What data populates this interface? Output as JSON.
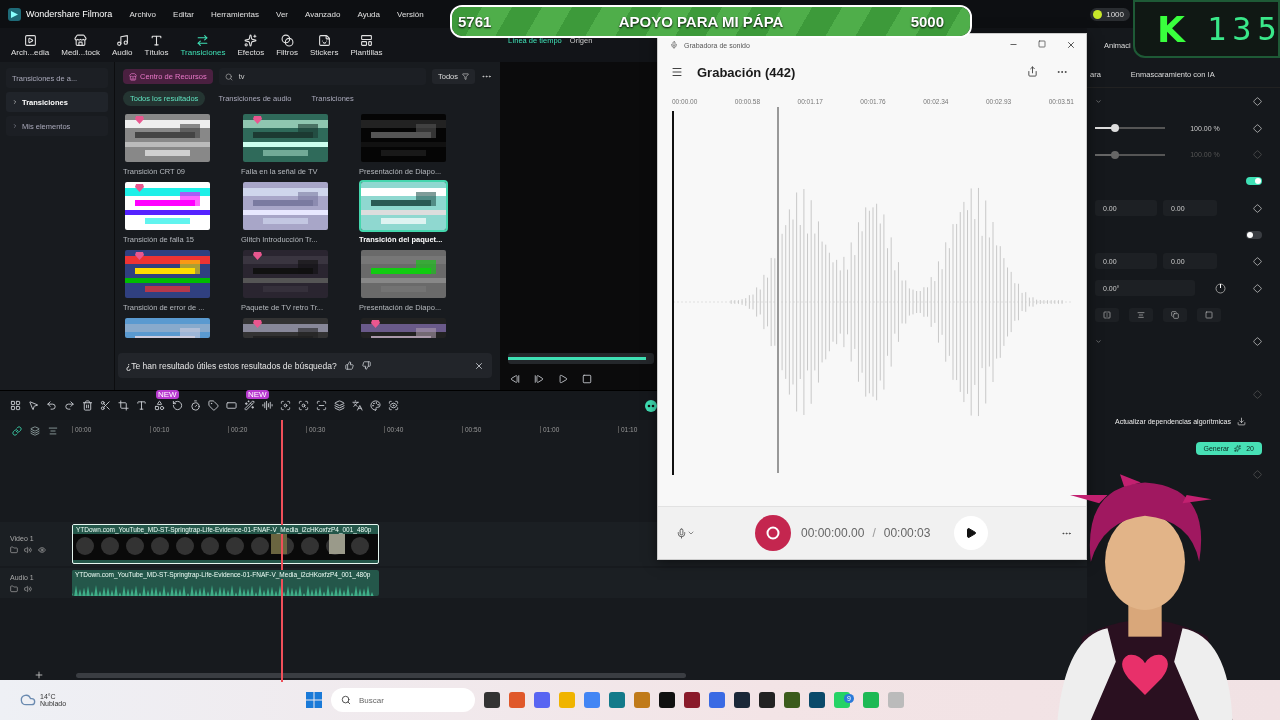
{
  "app": {
    "title": "Wondershare Filmora",
    "menu": [
      "Archivo",
      "Editar",
      "Herramientas",
      "Ver",
      "Avanzado",
      "Ayuda",
      "Versión"
    ],
    "credits": "1000"
  },
  "toolbar": [
    {
      "label": "Arch...edia",
      "selected": false
    },
    {
      "label": "Medi...tock",
      "selected": false
    },
    {
      "label": "Audio",
      "selected": false
    },
    {
      "label": "Títulos",
      "selected": false
    },
    {
      "label": "Transiciones",
      "selected": true
    },
    {
      "label": "Efectos",
      "selected": false
    },
    {
      "label": "Filtros",
      "selected": false
    },
    {
      "label": "Stickers",
      "selected": false
    },
    {
      "label": "Plantillas",
      "selected": false
    }
  ],
  "sidebar": [
    {
      "label": "Transiciones de a...",
      "selected": false
    },
    {
      "label": "Transiciones",
      "selected": true,
      "expanded": false
    },
    {
      "label": "Mis elementos",
      "selected": false,
      "expanded": false
    }
  ],
  "browser": {
    "resource_button": "Centro de Recursos",
    "search": {
      "value": "tv"
    },
    "filter": "Todos",
    "tabs": [
      {
        "label": "Todos los resultados",
        "selected": true
      },
      {
        "label": "Transiciones de audio",
        "selected": false
      },
      {
        "label": "Transiciones",
        "selected": false
      }
    ],
    "results": [
      {
        "title": "Transición CRT 09",
        "premium": true,
        "selected": false
      },
      {
        "title": "Falla en la señal de TV",
        "premium": true,
        "selected": false
      },
      {
        "title": "Presentación de Diapo...",
        "premium": false,
        "selected": false
      },
      {
        "title": "Transición de falla 15",
        "premium": true,
        "selected": false
      },
      {
        "title": "Glitch Introducción Tr...",
        "premium": false,
        "selected": false
      },
      {
        "title": "Transición del paquet...",
        "premium": false,
        "selected": true
      },
      {
        "title": "Transición de error de ...",
        "premium": true,
        "selected": false
      },
      {
        "title": "Paquete de TV retro Tr...",
        "premium": true,
        "selected": false
      },
      {
        "title": "Presentación de Diapo...",
        "premium": false,
        "selected": false
      },
      {
        "premium": false,
        "selected": false
      },
      {
        "premium": true,
        "selected": false
      },
      {
        "premium": true,
        "selected": false
      }
    ],
    "feedback": "¿Te han resultado útiles estos resultados de búsqueda?"
  },
  "preview": {
    "level": 1,
    "tabs": [
      {
        "label": "Línea de tiempo",
        "selected": true
      },
      {
        "label": "Origen",
        "selected": false
      }
    ]
  },
  "right_panel": {
    "tab_cut": "Animaci",
    "tabs": [
      {
        "label": "ara",
        "selected": false
      },
      {
        "label": "Enmascaramiento con IA",
        "selected": false
      }
    ],
    "rows": [
      {
        "kind": "section"
      },
      {
        "kind": "slider",
        "level": 0.28,
        "reading": "100.00 %",
        "disabled": false
      },
      {
        "kind": "slider",
        "level": 0.28,
        "reading": "100.00 %",
        "disabled": true
      },
      {
        "kind": "toggle",
        "on": true
      },
      {
        "kind": "pair",
        "values": [
          "0.00",
          "0.00"
        ]
      },
      {
        "kind": "toggle",
        "on": false
      },
      {
        "kind": "pair",
        "values": [
          "0.00",
          "0.00"
        ]
      },
      {
        "kind": "angle",
        "value": "0.00°"
      },
      {
        "kind": "tools"
      },
      {
        "kind": "section"
      },
      {
        "kind": "blank"
      },
      {
        "kind": "keyframe"
      },
      {
        "kind": "ai",
        "label": "Actualizar dependencias algorítmicas"
      },
      {
        "kind": "generate",
        "label": "Generar",
        "cost": "20"
      },
      {
        "kind": "keyframe"
      }
    ]
  },
  "timeline": {
    "new_badges": [
      "NEW",
      "NEW"
    ],
    "ruler": [
      "00:00",
      "00:10",
      "00:20",
      "00:30",
      "00:40",
      "00:50",
      "01:00",
      "01:10"
    ],
    "tracks": [
      {
        "kind": "video",
        "name": "Video 1",
        "clip": "YTDown.com_YouTube_MD-ST-Springtrap-Life-Evidence-01-FNAF-V_Media_i2cHKoxfzP4_001_480p"
      },
      {
        "kind": "audio",
        "name": "Audio 1",
        "clip": "YTDown.com_YouTube_MD-ST-Springtrap-Life-Evidence-01-FNAF-V_Media_i2cHKoxfzP4_001_480p"
      }
    ]
  },
  "recorder": {
    "app_title": "Grabadora de sonido",
    "title": "Grabación (442)",
    "ticks": [
      "00:00.00",
      "00:00.58",
      "00:01.17",
      "00:01.76",
      "00:02.34",
      "00:02.93",
      "00:03.51"
    ],
    "elapsed": "00:00:00.00",
    "separator": "/",
    "total": "00:00:03"
  },
  "stream_goal": {
    "current": "5761",
    "title": "APOYO PARA MI PÁPA",
    "goal": "5000",
    "level": 1
  },
  "counter": {
    "logo": "K",
    "value": "135"
  },
  "taskbar": {
    "temperature": "14°C",
    "condition": "Nublado",
    "search_placeholder": "Buscar",
    "app_badge": "9"
  }
}
